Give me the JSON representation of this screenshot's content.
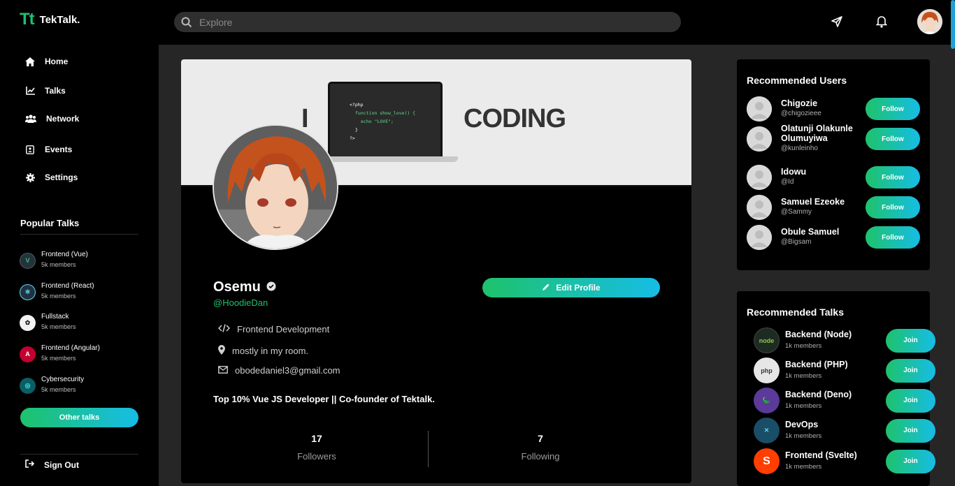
{
  "app": {
    "logo_mark": "Tt",
    "logo_text": "TekTalk."
  },
  "search": {
    "placeholder": "Explore"
  },
  "sidebar": {
    "nav": [
      {
        "label": "Home",
        "icon": "home-icon"
      },
      {
        "label": "Talks",
        "icon": "chart-icon"
      },
      {
        "label": "Network",
        "icon": "users-icon"
      },
      {
        "label": "Events",
        "icon": "contact-card-icon"
      },
      {
        "label": "Settings",
        "icon": "gear-icon"
      }
    ],
    "popular_title": "Popular Talks",
    "talks": [
      {
        "name": "Frontend (Vue)",
        "members": "5k members"
      },
      {
        "name": "Frontend (React)",
        "members": "5k members"
      },
      {
        "name": "Fullstack",
        "members": "5k members"
      },
      {
        "name": "Frontend (Angular)",
        "members": "5k members"
      },
      {
        "name": "Cybersecurity",
        "members": "5k members"
      }
    ],
    "other_talks": "Other talks",
    "sign_out": "Sign Out"
  },
  "profile": {
    "banner_left": "I",
    "banner_right": "CODING",
    "code_lines": [
      "<?php",
      "function show_love() {",
      "echo \"LOVE\";",
      "}",
      "?>"
    ],
    "name": "Osemu",
    "handle": "@HoodieDan",
    "edit_label": "Edit Profile",
    "role": "Frontend Development",
    "location": "mostly in my room.",
    "email": "obodedaniel3@gmail.com",
    "bio": "Top 10% Vue JS Developer || Co-founder of Tektalk.",
    "followers_count": "17",
    "followers_label": "Followers",
    "following_count": "7",
    "following_label": "Following"
  },
  "recommended_users": {
    "title": "Recommended Users",
    "follow_label": "Follow",
    "users": [
      {
        "name": "Chigozie",
        "handle": "@chigozieee"
      },
      {
        "name": "Olatunji Olakunle Olumuyiwa",
        "handle": "@kunleinho"
      },
      {
        "name": "Idowu",
        "handle": "@Id"
      },
      {
        "name": "Samuel Ezeoke",
        "handle": "@Sammy"
      },
      {
        "name": "Obule Samuel",
        "handle": "@Bigsam"
      }
    ]
  },
  "recommended_talks": {
    "title": "Recommended Talks",
    "join_label": "Join",
    "talks": [
      {
        "name": "Backend (Node)",
        "members": "1k members"
      },
      {
        "name": "Backend (PHP)",
        "members": "1k members"
      },
      {
        "name": "Backend (Deno)",
        "members": "1k members"
      },
      {
        "name": "DevOps",
        "members": "1k members"
      },
      {
        "name": "Frontend (Svelte)",
        "members": "1k members"
      }
    ]
  },
  "colors": {
    "accent_green": "#1ec26b",
    "accent_blue": "#16bde6",
    "background": "#262626",
    "panel": "#000000"
  }
}
